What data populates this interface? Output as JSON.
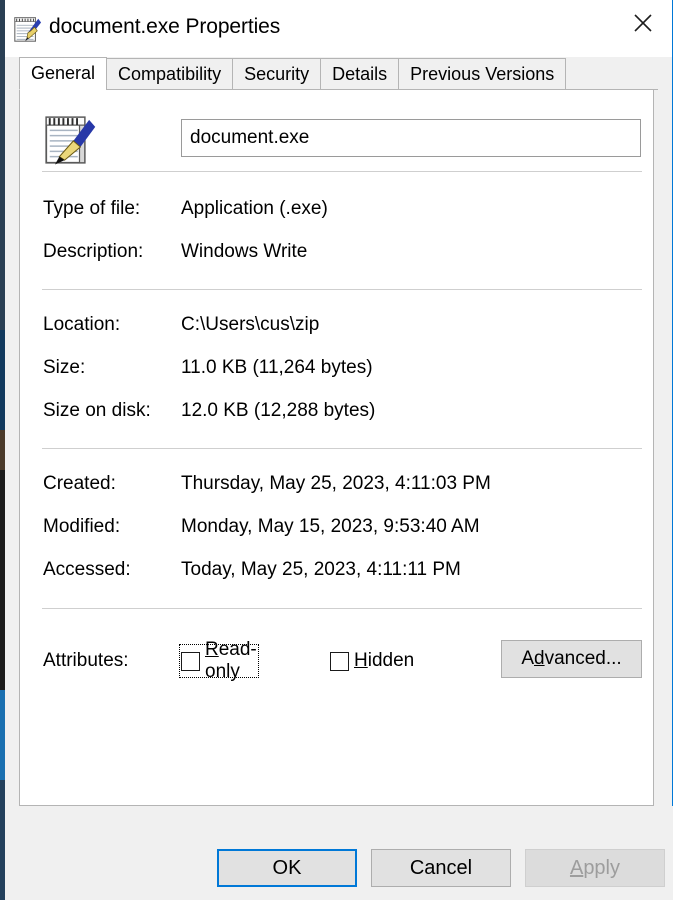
{
  "window": {
    "title": "document.exe Properties",
    "icon": "windows-write-document-icon",
    "close_label": "✕",
    "accent_color": "#0078d7"
  },
  "tabs": [
    {
      "label": "General",
      "selected": true
    },
    {
      "label": "Compatibility",
      "selected": false
    },
    {
      "label": "Security",
      "selected": false
    },
    {
      "label": "Details",
      "selected": false
    },
    {
      "label": "Previous Versions",
      "selected": false
    }
  ],
  "file": {
    "icon": "windows-write-document-icon",
    "name_value": "document.exe",
    "name_placeholder": ""
  },
  "properties": [
    {
      "label": "Type of file:",
      "value": "Application (.exe)"
    },
    {
      "label": "Description:",
      "value": "Windows Write"
    },
    {
      "label": "Location:",
      "value": "C:\\Users\\cus\\zip"
    },
    {
      "label": "Size:",
      "value": "11.0 KB (11,264 bytes)"
    },
    {
      "label": "Size on disk:",
      "value": "12.0 KB (12,288 bytes)"
    },
    {
      "label": "Created:",
      "value": "Thursday, May 25, 2023, 4:11:03 PM"
    },
    {
      "label": "Modified:",
      "value": "Monday, May 15, 2023, 9:53:40 AM"
    },
    {
      "label": "Accessed:",
      "value": "Today, May 25, 2023, 4:11:11 PM"
    }
  ],
  "attributes": {
    "label": "Attributes:",
    "readonly": {
      "label_pre": "",
      "accel": "R",
      "label_post": "ead-only",
      "checked": false,
      "focused": true
    },
    "hidden": {
      "label_pre": "",
      "accel": "H",
      "label_post": "idden",
      "checked": false,
      "focused": false
    },
    "advanced": {
      "label_pre": "A",
      "accel": "d",
      "label_post": "vanced..."
    }
  },
  "footer": {
    "ok_label": "OK",
    "cancel_label": "Cancel",
    "apply": {
      "label_pre": "",
      "accel": "A",
      "label_post": "pply",
      "disabled": true
    }
  }
}
